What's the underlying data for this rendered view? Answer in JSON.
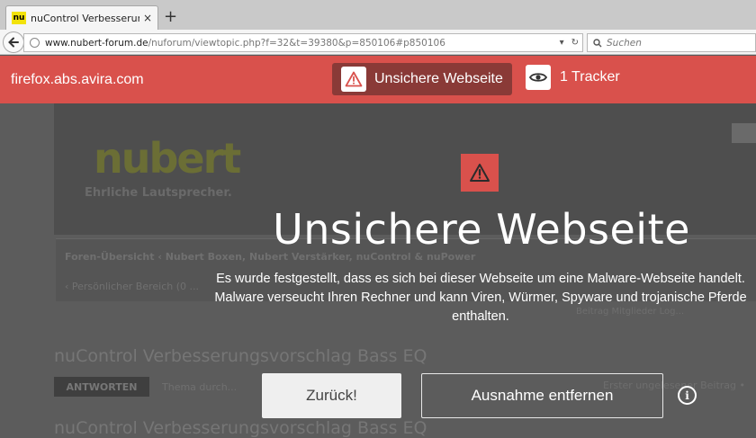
{
  "browser": {
    "tab_title": "nuControl Verbesserungsv...",
    "tab_close": "×",
    "new_tab": "+",
    "favicon_text": "nu",
    "url_host": "www.nubert-forum.de",
    "url_path": "/nuforum/viewtopic.php?f=32&t=39380&p=850106#p850106",
    "search_placeholder": "Suchen"
  },
  "avira_bar": {
    "site_name": "firefox.abs.avira.com",
    "warning_label": "Unsichere Webseite",
    "tracker_label": "1 Tracker",
    "color": "#d9514c"
  },
  "background_page": {
    "logo": "nubert",
    "tagline": "Ehrliche Lautsprecher.",
    "breadcrumb_1": "Foren-Übersicht ‹ Nubert Boxen, Nubert Verstärker, nuControl & nuPower",
    "breadcrumb_2": "‹ Persönlicher Bereich (0 ...",
    "side_text": "Beitrag   Mitglieder   Log...",
    "topic_title_1": "nuControl Verbesserungsvorschlag Bass EQ",
    "reply_button": "ANTWORTEN",
    "search_topic": "Thema durch...",
    "sort_text": "Erster ungelesener Beitrag •",
    "topic_title_2": "nuControl Verbesserungsvorschlag Bass EQ"
  },
  "warning": {
    "headline": "Unsichere Webseite",
    "message": "Es wurde festgestellt, dass es sich bei dieser Webseite um eine Malware-Webseite handelt. Malware verseucht Ihren Rechner und kann Viren, Würmer, Spyware und trojanische Pferde enthalten.",
    "back_button": "Zurück!",
    "remove_exception_button": "Ausnahme entfernen",
    "info_icon": "i"
  }
}
